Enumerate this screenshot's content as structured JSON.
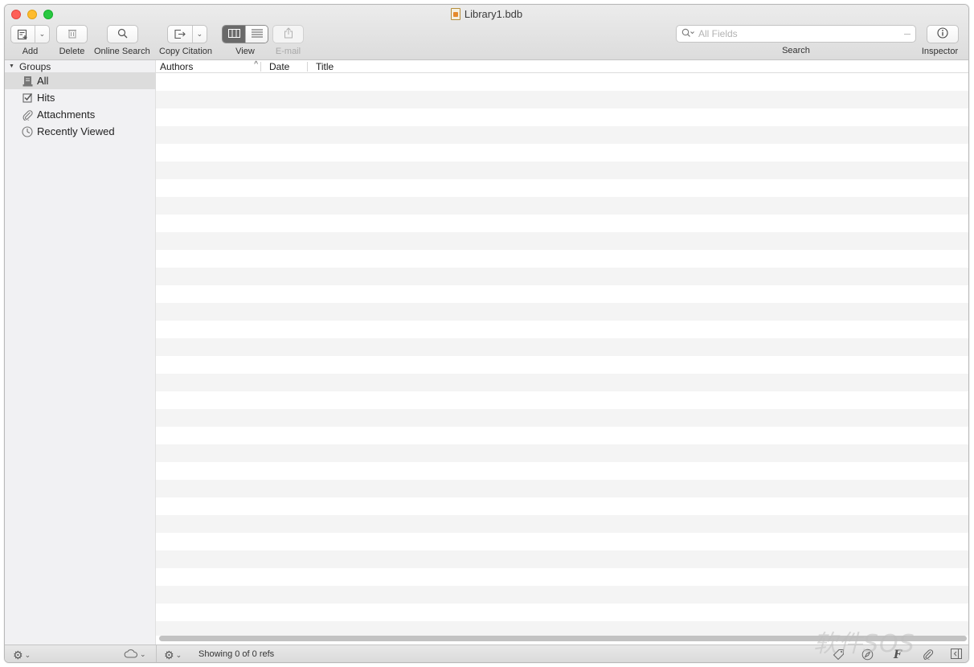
{
  "window": {
    "title": "Library1.bdb"
  },
  "toolbar": {
    "add_label": "Add",
    "delete_label": "Delete",
    "online_search_label": "Online Search",
    "copy_citation_label": "Copy Citation",
    "view_label": "View",
    "email_label": "E-mail",
    "search_label": "Search",
    "search_placeholder": "All Fields",
    "inspector_label": "Inspector"
  },
  "sidebar": {
    "groups_label": "Groups",
    "items": [
      {
        "label": "All",
        "icon": "library-icon",
        "selected": true
      },
      {
        "label": "Hits",
        "icon": "checkbox-icon",
        "selected": false
      },
      {
        "label": "Attachments",
        "icon": "paperclip-icon",
        "selected": false
      },
      {
        "label": "Recently Viewed",
        "icon": "clock-icon",
        "selected": false
      }
    ]
  },
  "table": {
    "columns": [
      {
        "label": "⌘"
      },
      {
        "label": "Authors",
        "sort": "ascending"
      },
      {
        "label": "Date"
      },
      {
        "label": "Title"
      }
    ],
    "rows": []
  },
  "statusbar": {
    "status_text": "Showing 0 of 0 refs"
  },
  "watermark": "软件SOS"
}
